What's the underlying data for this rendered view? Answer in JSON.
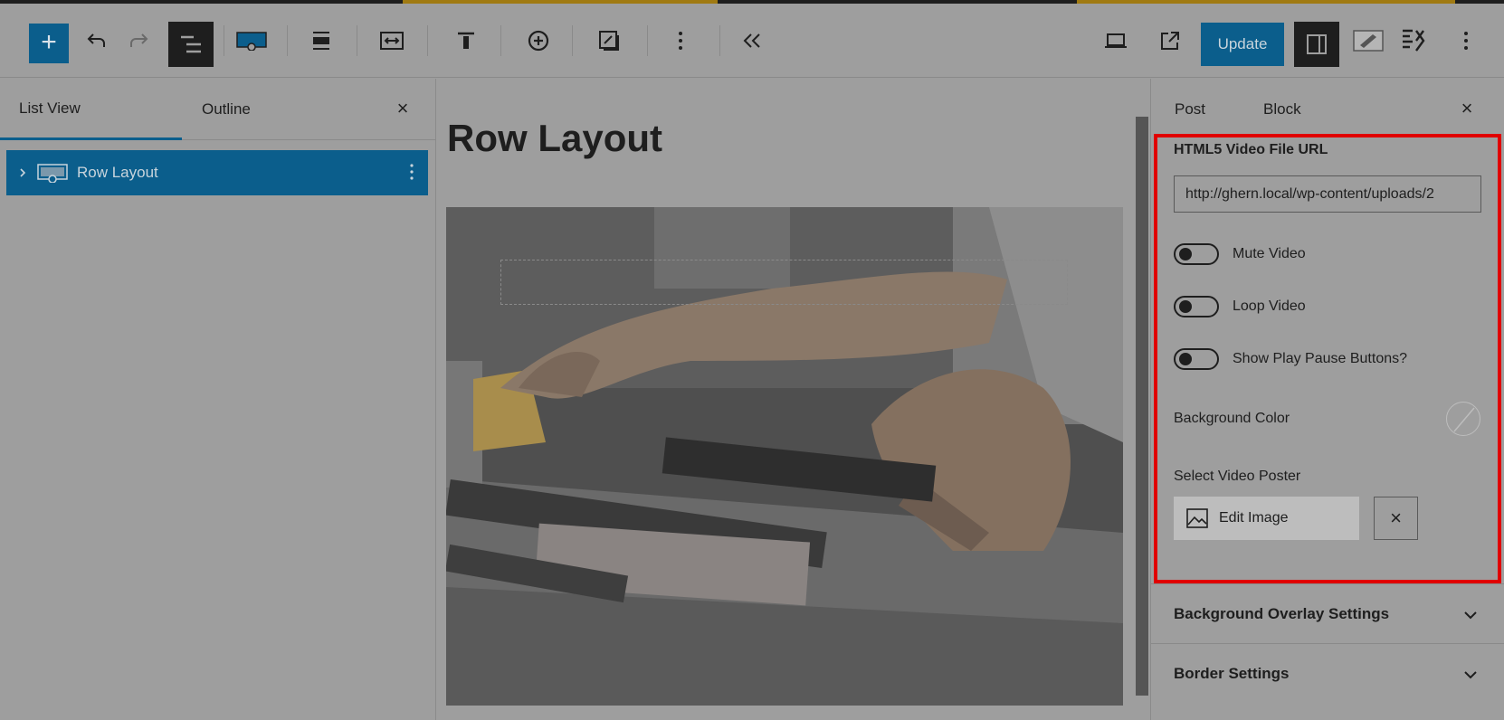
{
  "toolbar": {
    "inserter_label": "+",
    "update_label": "Update",
    "icons": [
      "plus-icon",
      "undo-icon",
      "redo-icon",
      "list-view-icon",
      "cover-block-icon",
      "align-icon",
      "full-width-icon",
      "justify-top-icon",
      "add-circle-icon",
      "edit-square-icon",
      "more-vertical-icon",
      "collapse-icon",
      "desktop-preview-icon",
      "external-link-icon",
      "settings-panel-icon",
      "editor-icon",
      "plugin-icon",
      "options-icon"
    ]
  },
  "left_panel": {
    "tabs": [
      {
        "label": "List View",
        "active": true
      },
      {
        "label": "Outline",
        "active": false
      }
    ],
    "close_label": "×",
    "items": [
      {
        "label": "Row Layout",
        "selected": true
      }
    ]
  },
  "canvas": {
    "title": "Row Layout"
  },
  "right_panel": {
    "tabs": [
      {
        "label": "Post"
      },
      {
        "label": "Block"
      }
    ],
    "close_label": "×",
    "video_url_label": "HTML5 Video File URL",
    "video_url_value": "http://ghern.local/wp-content/uploads/2",
    "toggles": [
      {
        "label": "Mute Video",
        "on": false
      },
      {
        "label": "Loop Video",
        "on": false
      },
      {
        "label": "Show Play Pause Buttons?",
        "on": false
      }
    ],
    "background_color_label": "Background Color",
    "video_poster_label": "Select Video Poster",
    "edit_image_label": "Edit Image",
    "remove_label": "×",
    "sections": [
      {
        "label": "Background Overlay Settings"
      },
      {
        "label": "Border Settings"
      }
    ]
  },
  "colors": {
    "accent": "#0b5e8c",
    "highlight_box": "#e00000"
  }
}
